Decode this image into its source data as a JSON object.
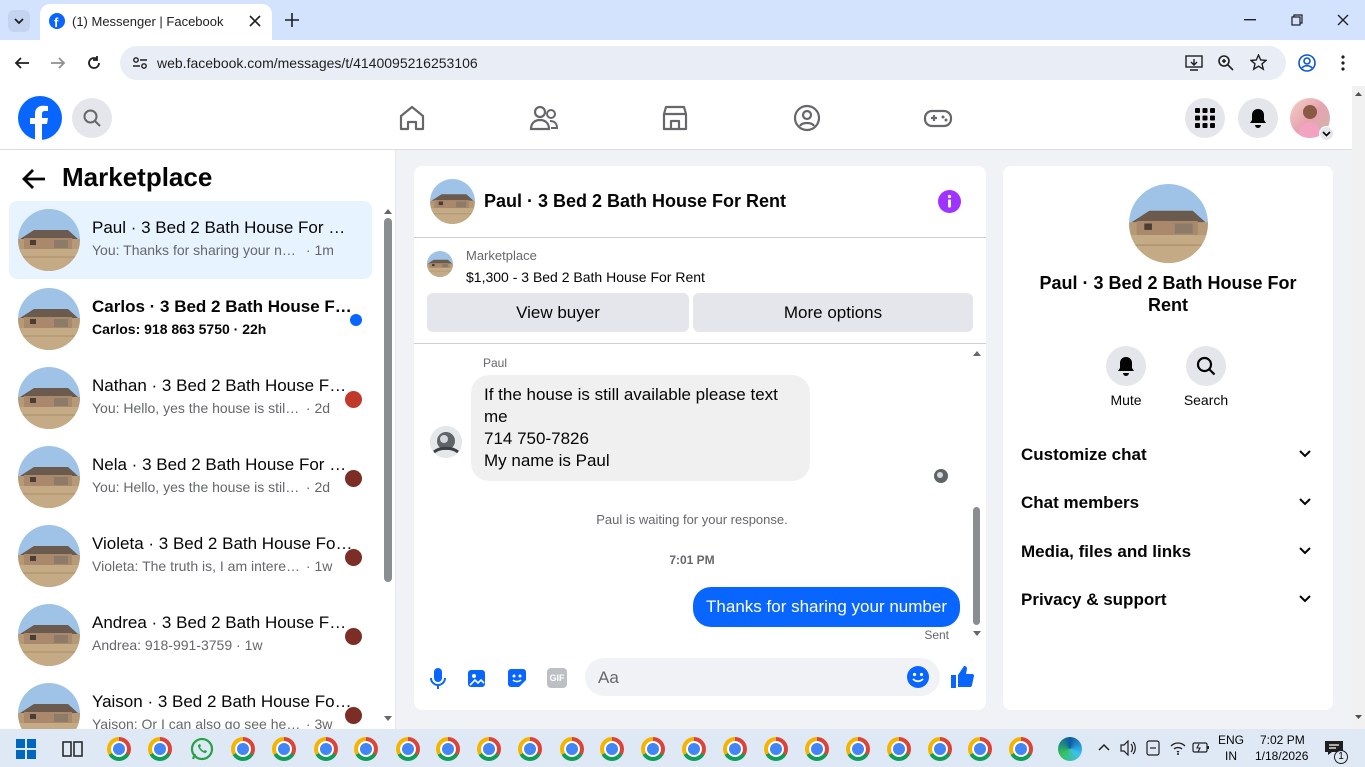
{
  "browser": {
    "tab_title": "(1) Messenger | Facebook",
    "url": "web.facebook.com/messages/t/4140095216253106"
  },
  "sidebar": {
    "title": "Marketplace",
    "conversations": [
      {
        "name": "Paul · 3 Bed 2 Bath House For Rent",
        "preview": "You: Thanks for sharing your number",
        "time": "1m",
        "active": true
      },
      {
        "name": "Carlos · 3 Bed 2 Bath House For Rent",
        "preview": "Carlos: 918 863 5750",
        "time": "22h",
        "unread": true
      },
      {
        "name": "Nathan · 3 Bed 2 Bath House For Rent",
        "preview": "You: Hello, yes the house is still available",
        "time": "2d"
      },
      {
        "name": "Nela · 3 Bed 2 Bath House For Rent",
        "preview": "You: Hello, yes the house is still available",
        "time": "2d"
      },
      {
        "name": "Violeta · 3 Bed 2 Bath House For Rent",
        "preview": "Violeta: The truth is, I am interested.",
        "time": "1w"
      },
      {
        "name": "Andrea · 3 Bed 2 Bath House For Rent",
        "preview": "Andrea: 918-991-3759",
        "time": "1w"
      },
      {
        "name": "Yaison · 3 Bed 2 Bath House For Rent",
        "preview": "Yaison: Or I can also go see her in t...",
        "time": "3w"
      }
    ]
  },
  "chat": {
    "title": "Paul · 3 Bed 2 Bath House For Rent",
    "listing_source": "Marketplace",
    "listing_title": "$1,300 - 3 Bed 2 Bath House For Rent",
    "view_buyer": "View buyer",
    "more_options": "More options",
    "sender_name": "Paul",
    "incoming_lines": [
      "If the house is still available please text me",
      "714 750-7826",
      "My name is Paul"
    ],
    "waiting_notice": "Paul is waiting for your response.",
    "timestamp": "7:01 PM",
    "outgoing_message": "Thanks for sharing your number",
    "sent_status": "Sent",
    "input_placeholder": "Aa",
    "gif_label": "GIF"
  },
  "details": {
    "name": "Paul · 3 Bed 2 Bath House For Rent",
    "mute": "Mute",
    "search": "Search",
    "sections": [
      "Customize chat",
      "Chat members",
      "Media, files and links",
      "Privacy & support"
    ]
  },
  "taskbar": {
    "lang": "ENG",
    "region": "IN",
    "time": "7:02 PM",
    "date": "1/18/2026",
    "notif_count": "1"
  },
  "colors": {
    "brand": "#0866ff",
    "info_purple": "#a033ff",
    "active_row": "#e7f3ff"
  }
}
